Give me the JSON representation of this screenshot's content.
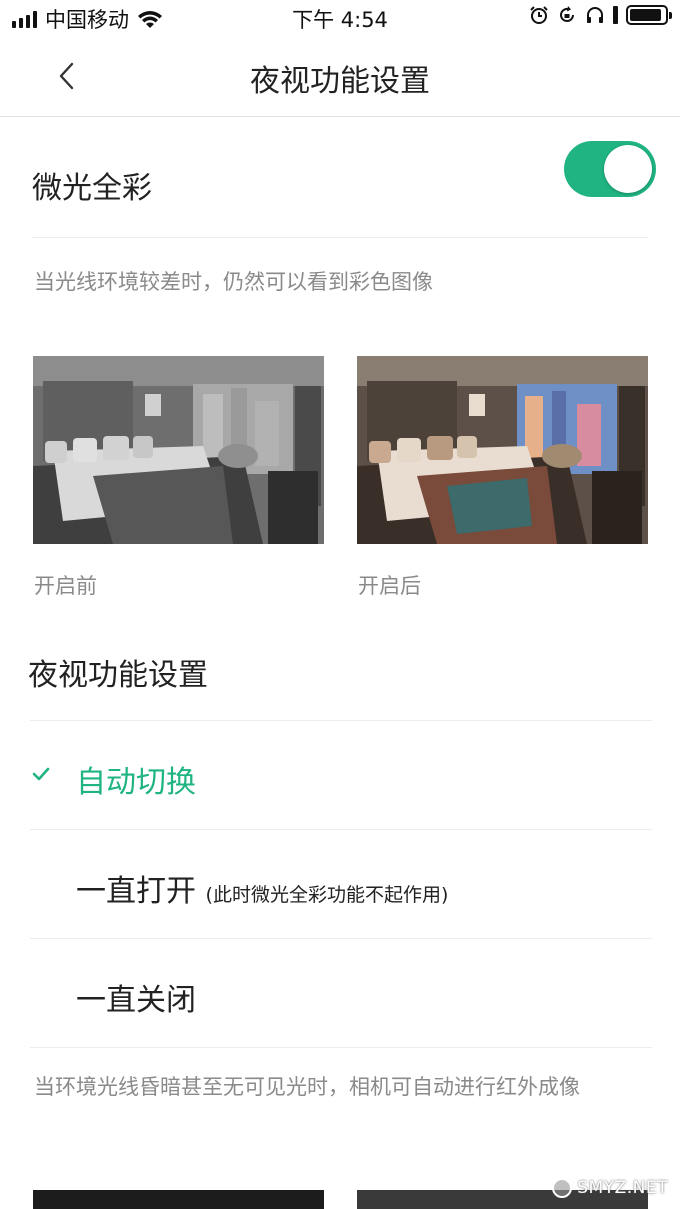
{
  "status_bar": {
    "carrier": "中国移动",
    "time": "下午 4:54",
    "battery_level": 0.9
  },
  "nav": {
    "title": "夜视功能设置"
  },
  "low_light": {
    "label": "微光全彩",
    "enabled": true,
    "description": "当光线环境较差时，仍然可以看到彩色图像",
    "before_caption": "开启前",
    "after_caption": "开启后"
  },
  "night_vision": {
    "section_title": "夜视功能设置",
    "options": [
      {
        "label": "自动切换",
        "note": "",
        "selected": true
      },
      {
        "label": "一直打开",
        "note": "(此时微光全彩功能不起作用)",
        "selected": false
      },
      {
        "label": "一直关闭",
        "note": "",
        "selected": false
      }
    ],
    "description": "当环境光线昏暗甚至无可见光时，相机可自动进行红外成像"
  },
  "watermark": {
    "text": "SMYZ.NET"
  },
  "colors": {
    "accent": "#20b482",
    "secondary_text": "#8a8a8a",
    "primary_text": "#222222"
  }
}
